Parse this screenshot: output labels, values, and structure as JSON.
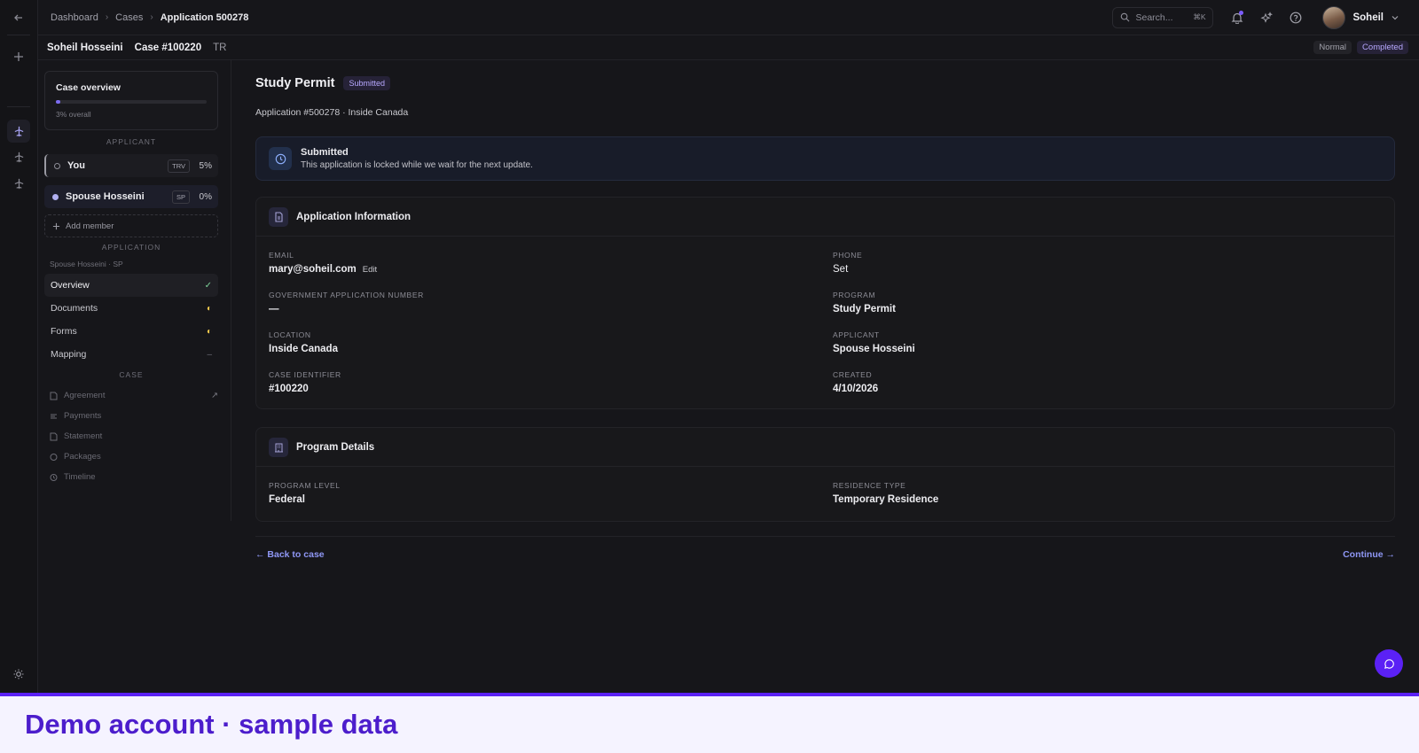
{
  "breadcrumb": {
    "items": [
      "Dashboard",
      "Cases"
    ],
    "current": "Application 500278"
  },
  "search": {
    "placeholder": "Search...",
    "shortcut": "⌘K"
  },
  "user": {
    "name": "Soheil"
  },
  "case_header": {
    "name": "Soheil Hosseini",
    "number": "Case #100220",
    "code": "TR",
    "priority": "Normal",
    "status": "Completed"
  },
  "sidebar": {
    "overview": {
      "title": "Case overview",
      "progress_percent": 3,
      "progress_label": "3% overall"
    },
    "applicant_label": "APPLICANT",
    "members": [
      {
        "name": "You",
        "tag": "TRV",
        "percent": "5%"
      },
      {
        "name": "Spouse Hosseini",
        "tag": "SP",
        "percent": "0%"
      }
    ],
    "add_member": "Add member",
    "application_label": "APPLICATION",
    "application_sub": "Spouse Hosseini · SP",
    "nav": [
      {
        "label": "Overview",
        "status": "✓"
      },
      {
        "label": "Documents",
        "status": "◐"
      },
      {
        "label": "Forms",
        "status": "◐"
      },
      {
        "label": "Mapping",
        "status": "–"
      }
    ],
    "case_label": "CASE",
    "case_items": [
      "Agreement",
      "Payments",
      "Statement",
      "Packages",
      "Timeline"
    ]
  },
  "main": {
    "title": "Study Permit",
    "status_pill": "Submitted",
    "meta": "Application #500278 · Inside Canada",
    "alert": {
      "title": "Submitted",
      "body": "This application is locked while we wait for the next update."
    },
    "app_info": {
      "title": "Application Information",
      "email_label": "EMAIL",
      "email": "mary@soheil.com",
      "edit": "Edit",
      "phone_label": "PHONE",
      "phone": "Set",
      "gov_label": "GOVERNMENT APPLICATION NUMBER",
      "gov": "—",
      "program_label": "PROGRAM",
      "program": "Study Permit",
      "location_label": "LOCATION",
      "location": "Inside Canada",
      "applicant_label": "APPLICANT",
      "applicant": "Spouse Hosseini",
      "case_id_label": "CASE IDENTIFIER",
      "case_id": "#100220",
      "created_label": "CREATED",
      "created": "4/10/2026"
    },
    "program_details": {
      "title": "Program Details",
      "level_label": "PROGRAM LEVEL",
      "level": "Federal",
      "residence_label": "RESIDENCE TYPE",
      "residence": "Temporary Residence"
    },
    "back_link": "← Back to case",
    "continue_link": "Continue →"
  },
  "banner": {
    "text": "Demo account · sample data"
  },
  "colors": {
    "accent": "#7c6cf0",
    "brand": "#5b21f5",
    "link": "#8f97f5",
    "background": "#16161a"
  }
}
